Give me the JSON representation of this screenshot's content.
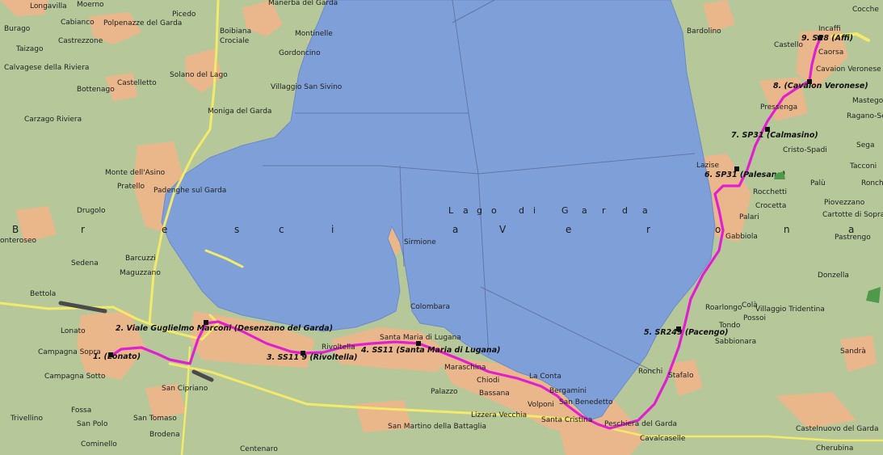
{
  "lake": {
    "name_letters": [
      "L",
      "a",
      "g",
      "o",
      " ",
      "d",
      "i",
      " ",
      "G",
      "a",
      "r",
      "d",
      "a"
    ],
    "brescia_letters": [
      "e",
      "s",
      "c",
      "i",
      "a",
      "V",
      "e",
      "r"
    ],
    "brescia_extra": [
      "B",
      "r",
      "o",
      "n",
      "a"
    ]
  },
  "towns": [
    "Longavilla",
    "Moerno",
    "Cabianco",
    "Polpenazze del Garda",
    "Picedo",
    "Manerba del Garda",
    "Burago",
    "Castrezzone",
    "Taizago",
    "Boibiana",
    "Crociale",
    "Montinelle",
    "Calvagese della Riviera",
    "Solano del Lago",
    "Gordoncino",
    "Bottenago",
    "Castelletto",
    "Villaggio San Sivino",
    "Moniga del Garda",
    "Carzago Riviera",
    "Monte dell'Asino",
    "Pratello",
    "Padenghe sul Garda",
    "Drugolo",
    "onteroseo",
    "Sedena",
    "Barcuzzi",
    "Maguzzano",
    "Bettola",
    "Lonato",
    "Campagna Sopra",
    "Campagna Sotto",
    "San Cipriano",
    "Fossa",
    "Trivellino",
    "San Polo",
    "San Tomaso",
    "Brodena",
    "Cominello",
    "Centenaro",
    "Sirmione",
    "Colombara",
    "Rivoltella",
    "Santa Maria di Lugana",
    "Maraschina",
    "Chiodi",
    "Palazzo",
    "Bassana",
    "Volponi",
    "Lizzera Vecchia",
    "San Martino della Battaglia",
    "La Conta",
    "Bergamini",
    "San Benedetto",
    "Santa Cristina",
    "Peschiera del Garda",
    "Cavalcaselle",
    "Ronchi",
    "Stafalo",
    "Roarlongo",
    "Tondo",
    "Sabbionara",
    "Colà",
    "Villaggio Tridentina",
    "Possoi",
    "Gabbiola",
    "Palari",
    "Crocetta",
    "Rocchetti",
    "Lazise",
    "Cristo-Spadi",
    "Pressenga",
    "Cavaion Veronese",
    "Caorsa",
    "Incaffi",
    "Castello",
    "Bardolino",
    "Cocche",
    "Mastego",
    "Ragano-Sega",
    "Sega",
    "Tacconi",
    "Ronchi",
    "Palù",
    "Piovezzano",
    "Cartotte di Sopra",
    "Pastrengo",
    "Donzella",
    "Sandrà",
    "Castelnuovo del Garda",
    "Cherubina"
  ],
  "route_labels": [
    "1. (Lonato)",
    "2. Viale Guglielmo Marconi (Desenzano del Garda)",
    "3. SS11 9 (Rivoltella)",
    "4. SS11 (Santa Maria di Lugana)",
    "5. SR249 (Pacengo)",
    "6. SP31 (Palesana)",
    "7. SP31 (Calmasino)",
    "8. (Cavaion Veronese)",
    "9. SP8 (Affi)"
  ],
  "colors": {
    "land": "#b6c89a",
    "urban": "#f0b58a",
    "water": "#7f9fd9",
    "route": "#e020d0",
    "road_major": "#f2ea6a",
    "road_highway": "#4a4a4a"
  }
}
